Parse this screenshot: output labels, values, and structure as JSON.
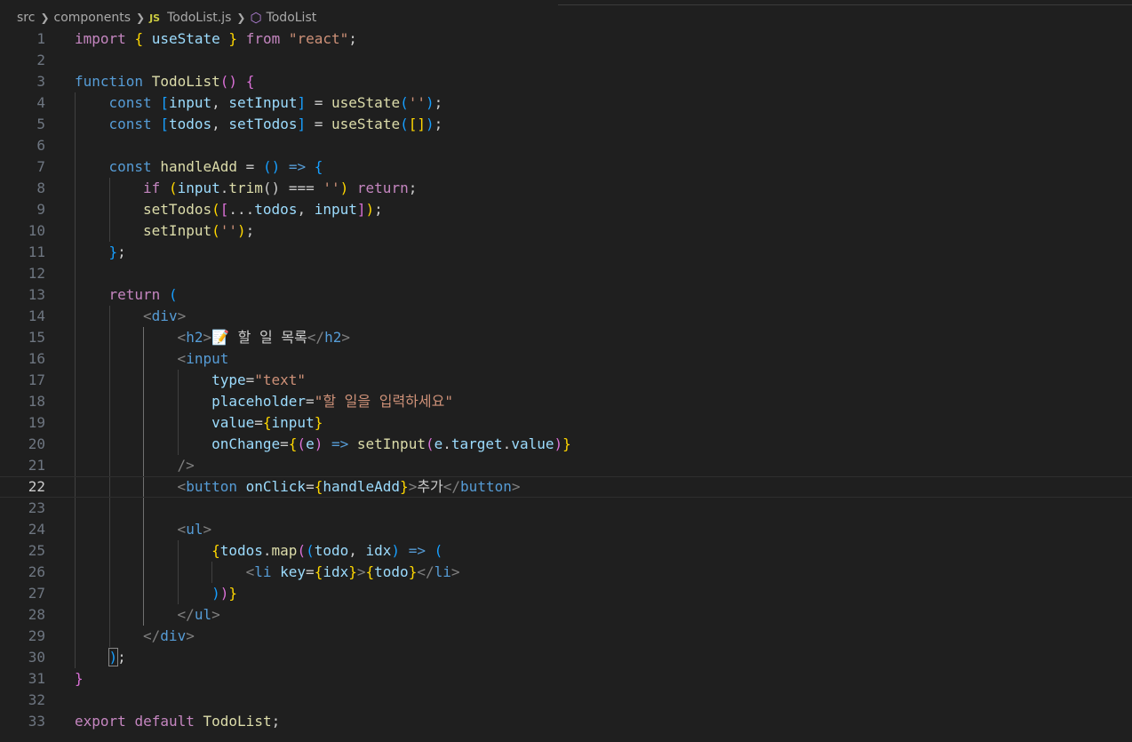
{
  "breadcrumb": {
    "folder1": "src",
    "folder2": "components",
    "file_badge": "JS",
    "file": "TodoList.js",
    "symbol": "TodoList"
  },
  "editor": {
    "current_line": 22,
    "line_numbers": [
      "1",
      "2",
      "3",
      "4",
      "5",
      "6",
      "7",
      "8",
      "9",
      "10",
      "11",
      "12",
      "13",
      "14",
      "15",
      "16",
      "17",
      "18",
      "19",
      "20",
      "21",
      "22",
      "23",
      "24",
      "25",
      "26",
      "27",
      "28",
      "29",
      "30",
      "31",
      "32",
      "33"
    ],
    "code": {
      "l1": [
        "import",
        " ",
        "{",
        " useState ",
        "}",
        " ",
        "from",
        " ",
        "\"react\"",
        ";"
      ],
      "l3": [
        "function",
        " ",
        "TodoList",
        "(",
        ")",
        " ",
        "{"
      ],
      "l4": [
        "const",
        " ",
        "[",
        "input",
        ", ",
        "setInput",
        "]",
        " = ",
        "useState",
        "(",
        "''",
        ")",
        ";"
      ],
      "l5": [
        "const",
        " ",
        "[",
        "todos",
        ", ",
        "setTodos",
        "]",
        " = ",
        "useState",
        "(",
        "[",
        "]",
        ")",
        ";"
      ],
      "l7": [
        "const",
        " ",
        "handleAdd",
        " = ",
        "(",
        ")",
        " ",
        "=>",
        " ",
        "{"
      ],
      "l8": [
        "if",
        " ",
        "(",
        "input",
        ".",
        "trim",
        "()",
        " === ",
        "''",
        ")",
        " ",
        "return",
        ";"
      ],
      "l9": [
        "setTodos",
        "(",
        "[",
        "...",
        "todos",
        ", ",
        "input",
        "]",
        ")",
        ";"
      ],
      "l10": [
        "setInput",
        "(",
        "''",
        ")",
        ";"
      ],
      "l11": [
        "}",
        ";"
      ],
      "l13": [
        "return",
        " ",
        "("
      ],
      "l14": [
        "<",
        "div",
        ">"
      ],
      "l15": [
        "<",
        "h2",
        ">",
        "📝 할 일 목록",
        "</",
        "h2",
        ">"
      ],
      "l16": [
        "<",
        "input"
      ],
      "l17": [
        "type",
        "=",
        "\"text\""
      ],
      "l18": [
        "placeholder",
        "=",
        "\"할 일을 입력하세요\""
      ],
      "l19": [
        "value",
        "=",
        "{",
        "input",
        "}"
      ],
      "l20": [
        "onChange",
        "=",
        "{",
        "(",
        "e",
        ")",
        " ",
        "=>",
        " ",
        "setInput",
        "(",
        "e",
        ".",
        "target",
        ".",
        "value",
        ")",
        "}"
      ],
      "l21": [
        "/>"
      ],
      "l22": [
        "<",
        "button",
        " ",
        "onClick",
        "=",
        "{",
        "handleAdd",
        "}",
        ">",
        "추가",
        "</",
        "button",
        ">"
      ],
      "l24": [
        "<",
        "ul",
        ">"
      ],
      "l25": [
        "{",
        "todos",
        ".",
        "map",
        "(",
        "(",
        "todo",
        ", ",
        "idx",
        ")",
        " ",
        "=>",
        " ",
        "("
      ],
      "l26": [
        "<",
        "li",
        " ",
        "key",
        "=",
        "{",
        "idx",
        "}",
        ">",
        "{",
        "todo",
        "}",
        "</",
        "li",
        ">"
      ],
      "l27": [
        ")",
        ")",
        "}"
      ],
      "l28": [
        "</",
        "ul",
        ">"
      ],
      "l29": [
        "</",
        "div",
        ">"
      ],
      "l30": [
        ")",
        ";"
      ],
      "l31": [
        "}"
      ],
      "l33": [
        "export",
        " ",
        "default",
        " ",
        "TodoList",
        ";"
      ]
    }
  }
}
